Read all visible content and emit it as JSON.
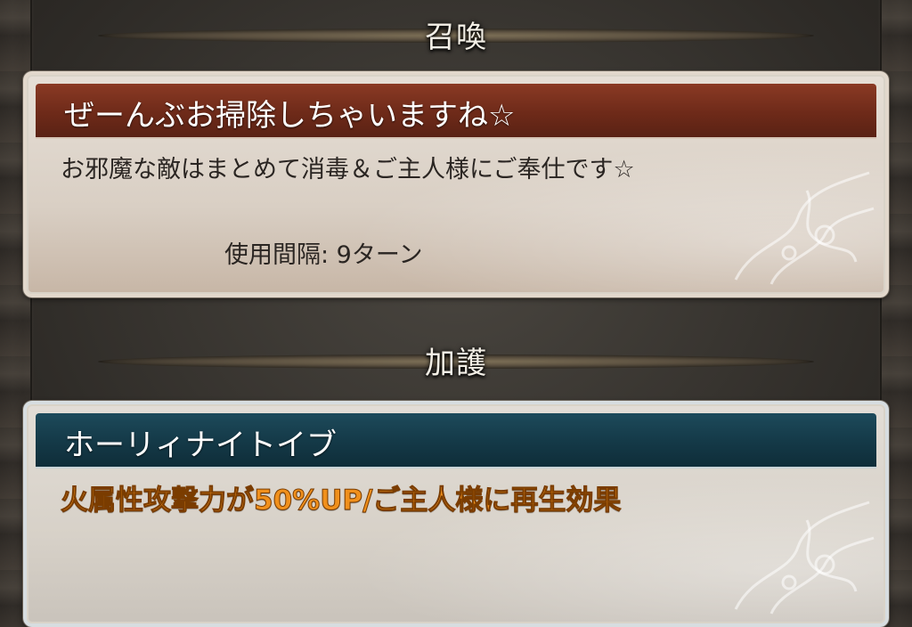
{
  "summon_section": {
    "header": "召喚",
    "skill_name": "ぜーんぶお掃除しちゃいますね☆",
    "description": "お邪魔な敵はまとめて消毒＆ご主人様にご奉仕です☆",
    "cooldown": "使用間隔: 9ターン"
  },
  "blessing_section": {
    "header": "加護",
    "skill_name": "ホーリィナイトイブ",
    "description": "火属性攻撃力が50%UP/ご主人様に再生効果"
  },
  "colors": {
    "summon_title_bar": "#6e2a19",
    "blessing_title_bar": "#143947",
    "blessing_text": "#f0901c"
  }
}
